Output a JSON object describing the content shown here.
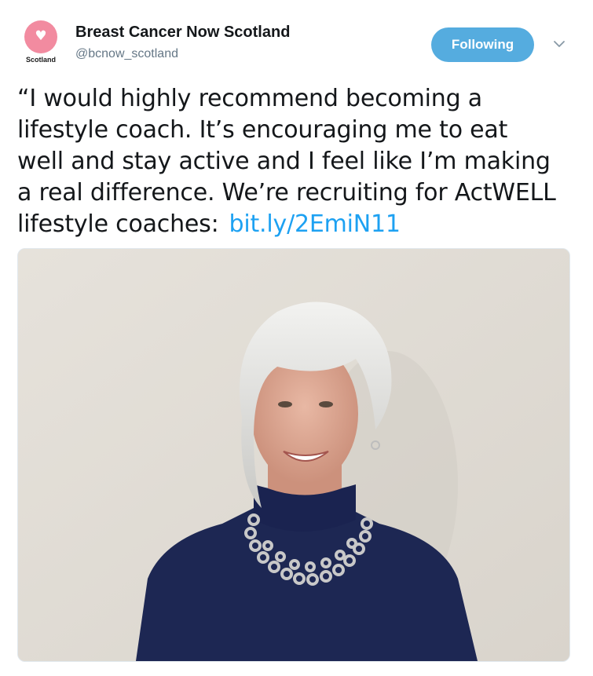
{
  "account": {
    "display_name": "Breast Cancer Now Scotland",
    "screen_name": "@bcnow_scotland",
    "avatar_label": "Scotland"
  },
  "follow_button": {
    "label": "Following"
  },
  "tweet": {
    "lines": [
      "“I would highly recommend becoming a",
      "lifestyle coach.  It’s encouraging me to eat",
      "well and stay active and I feel like I’m making",
      "a real difference. We’re recruiting for ActWELL",
      "lifestyle coaches:"
    ],
    "link": "bit.ly/2EmiN11"
  },
  "colors": {
    "follow_button_bg": "#55acdf",
    "link": "#1da1f2",
    "avatar_bg": "#f28ba0",
    "handle": "#657786"
  },
  "icons": {
    "avatar": "pink-heart-logo",
    "menu": "chevron-down-icon"
  }
}
